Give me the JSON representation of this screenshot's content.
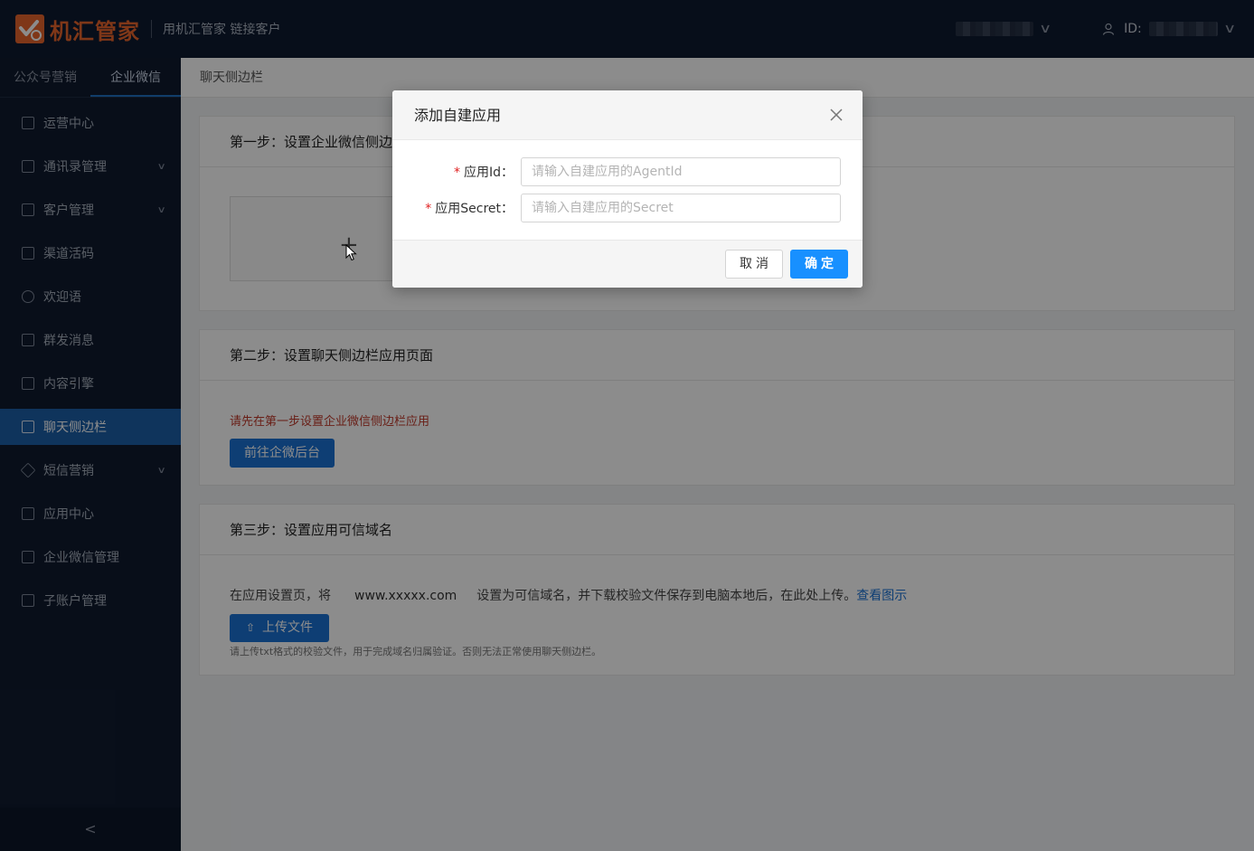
{
  "brand": {
    "name": "机汇管家",
    "slogan": "用机汇管家 链接客户",
    "color": "#e8642c"
  },
  "topbar": {
    "id_label": "ID:"
  },
  "sidebar": {
    "tabs": [
      {
        "label": "公众号营销",
        "active": false
      },
      {
        "label": "企业微信",
        "active": true
      }
    ],
    "items": [
      {
        "label": "运营中心",
        "icon": "home-icon",
        "has_arrow": false
      },
      {
        "label": "通讯录管理",
        "icon": "contacts-icon",
        "has_arrow": true
      },
      {
        "label": "客户管理",
        "icon": "customer-icon",
        "has_arrow": true
      },
      {
        "label": "渠道活码",
        "icon": "qrcode-icon",
        "has_arrow": false
      },
      {
        "label": "欢迎语",
        "icon": "message-icon",
        "has_arrow": false
      },
      {
        "label": "群发消息",
        "icon": "broadcast-icon",
        "has_arrow": false
      },
      {
        "label": "内容引擎",
        "icon": "content-icon",
        "has_arrow": false
      },
      {
        "label": "聊天侧边栏",
        "icon": "sidebar-icon",
        "has_arrow": false,
        "active": true
      },
      {
        "label": "短信营销",
        "icon": "sms-icon",
        "has_arrow": true
      },
      {
        "label": "应用中心",
        "icon": "apps-icon",
        "has_arrow": false
      },
      {
        "label": "企业微信管理",
        "icon": "wecom-icon",
        "has_arrow": false
      },
      {
        "label": "子账户管理",
        "icon": "subaccount-icon",
        "has_arrow": false
      }
    ],
    "collapse_glyph": "<"
  },
  "breadcrumb": "聊天侧边栏",
  "steps": {
    "step1_title": "第一步：设置企业微信侧边栏应用",
    "step2_title": "第二步：设置聊天侧边栏应用页面",
    "step2_warning": "请先在第一步设置企业微信侧边栏应用",
    "step2_button": "前往企微后台",
    "step3_title": "第三步：设置应用可信域名",
    "step3_text_before": "在应用设置页，将",
    "step3_domain": "www.xxxxx.com",
    "step3_text_after": "设置为可信域名，并下载校验文件保存到电脑本地后，在此处上传。",
    "step3_link": "查看图示",
    "step3_upload_button": "上传文件",
    "step3_hint": "请上传txt格式的校验文件，用于完成域名归属验证。否则无法正常使用聊天侧边栏。"
  },
  "modal": {
    "title": "添加自建应用",
    "fields": [
      {
        "label": "应用Id：",
        "placeholder": "请输入自建应用的AgentId",
        "value": ""
      },
      {
        "label": "应用Secret：",
        "placeholder": "请输入自建应用的Secret",
        "value": ""
      }
    ],
    "cancel_label": "取消",
    "ok_label": "确定",
    "primary_color": "#1890ff"
  }
}
